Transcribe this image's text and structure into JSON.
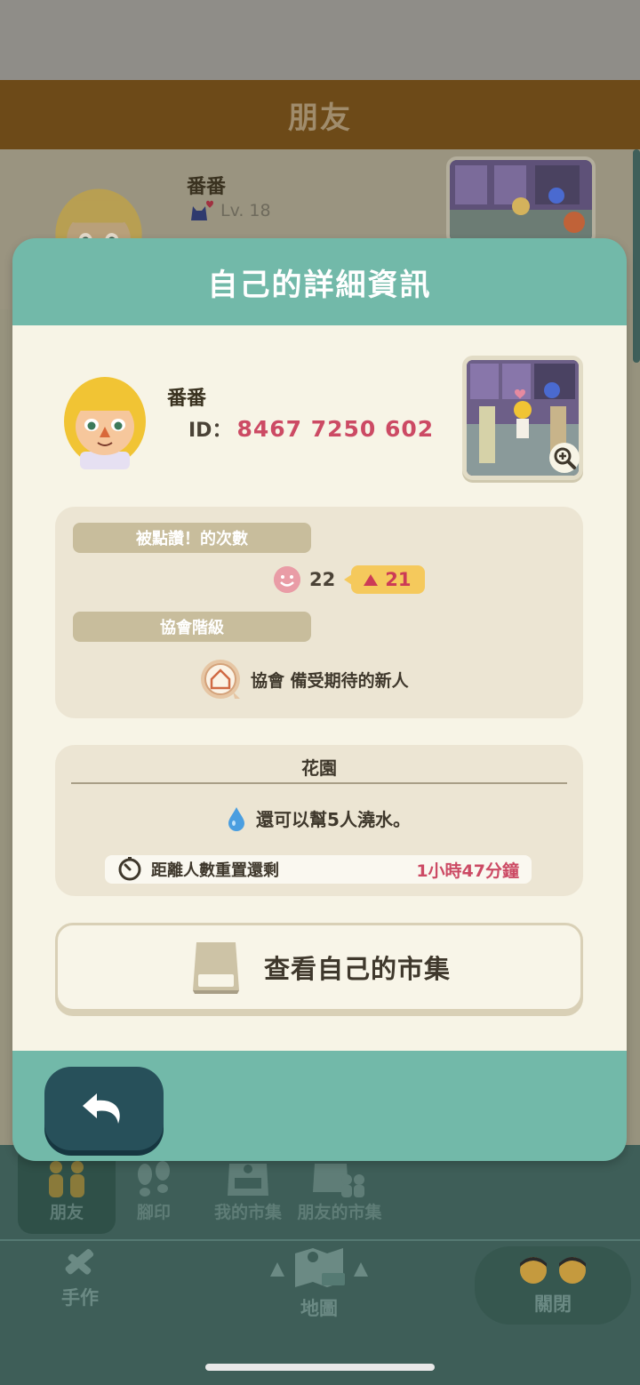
{
  "background": {
    "header_title": "朋友",
    "friend": {
      "name": "番番",
      "level": "Lv. 18"
    },
    "tabs": [
      {
        "label": "朋友",
        "icon": "friends-icon"
      },
      {
        "label": "腳印",
        "icon": "footprints-icon"
      },
      {
        "label": "我的市集",
        "icon": "my-market-icon"
      },
      {
        "label": "朋友的市集",
        "icon": "friends-market-icon"
      }
    ],
    "nav": {
      "crafting": "手作",
      "map": "地圖",
      "close": "關閉"
    }
  },
  "dialog": {
    "title": "自己的詳細資訊",
    "profile": {
      "name": "番番",
      "id_label": "ID：",
      "id_value": "8467 7250 602"
    },
    "likes": {
      "section_label": "被點讚！的次數",
      "count": "22",
      "rank_change": "21"
    },
    "association": {
      "section_label": "協會階級",
      "rank_text": "協會 備受期待的新人"
    },
    "garden": {
      "title": "花園",
      "water_text": "還可以幫5人澆水。",
      "reset_label": "距離人數重置還剩",
      "reset_value": "1小時47分鐘"
    },
    "market_button_label": "查看自己的市集"
  },
  "colors": {
    "teal": "#72b9a9",
    "cream": "#f7f4e6",
    "accent_red": "#cc4a64",
    "badge_yellow": "#f5c95c",
    "back_button": "#27505a"
  }
}
